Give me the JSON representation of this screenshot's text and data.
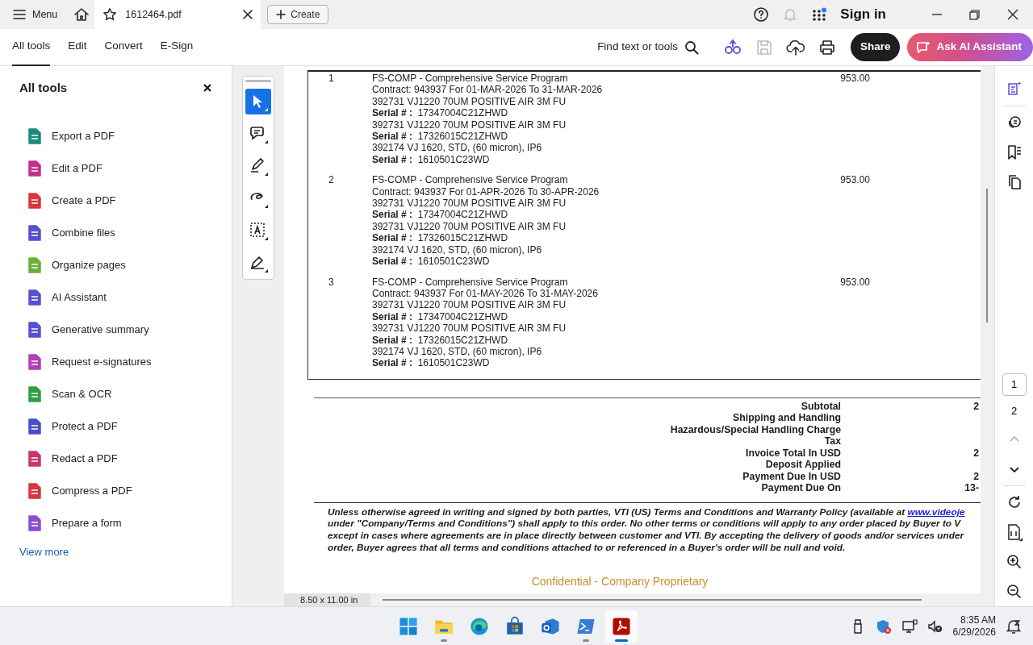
{
  "title_bar": {
    "menu": "Menu",
    "tab_title": "1612464.pdf",
    "create": "Create",
    "sign_in": "Sign in",
    "notifications_disabled": true
  },
  "toolbar": {
    "tabs": [
      {
        "label": "All tools",
        "selected": true
      },
      {
        "label": "Edit",
        "selected": false
      },
      {
        "label": "Convert",
        "selected": false
      },
      {
        "label": "E-Sign",
        "selected": false
      }
    ],
    "find": "Find text or tools",
    "save_disabled": true,
    "share": "Share",
    "ai_assistant": "Ask AI Assistant"
  },
  "tools_panel": {
    "title": "All tools",
    "items": [
      {
        "label": "Export a PDF",
        "color": "#1b8a7a"
      },
      {
        "label": "Edit a PDF",
        "color": "#c72f8c"
      },
      {
        "label": "Create a PDF",
        "color": "#d7373f"
      },
      {
        "label": "Combine files",
        "color": "#5a4fcf"
      },
      {
        "label": "Organize pages",
        "color": "#6bb036"
      },
      {
        "label": "AI Assistant",
        "color": "#5a4fcf"
      },
      {
        "label": "Generative summary",
        "color": "#5a4fcf"
      },
      {
        "label": "Request e-signatures",
        "color": "#b23fb5"
      },
      {
        "label": "Scan & OCR",
        "color": "#2f9e44"
      },
      {
        "label": "Protect a PDF",
        "color": "#4b4fc4"
      },
      {
        "label": "Redact a PDF",
        "color": "#c7356f"
      },
      {
        "label": "Compress a PDF",
        "color": "#d7373f"
      },
      {
        "label": "Prepare a form",
        "color": "#8a4fcf"
      }
    ],
    "view_more": "View more"
  },
  "quick_tools": [
    {
      "kind": "select",
      "selected": true
    },
    {
      "kind": "comment",
      "selected": false
    },
    {
      "kind": "highlight",
      "selected": false
    },
    {
      "kind": "draw",
      "selected": false
    },
    {
      "kind": "text",
      "selected": false
    },
    {
      "kind": "sign",
      "selected": false
    }
  ],
  "document": {
    "rows": [
      {
        "line": "1",
        "price": "953.00",
        "description": [
          "FS-COMP - Comprehensive Service Program",
          "Contract: 943937 For 01-MAR-2026 To 31-MAR-2026",
          "392731 VJ1220 70UM POSITIVE AIR 3M FU",
          "**Serial # :**  17347004C21ZHWD",
          "392731 VJ1220 70UM POSITIVE AIR 3M FU",
          "**Serial # :**  17326015C21ZHWD",
          "392174 VJ 1620, STD, (60 micron), IP6",
          "**Serial # :**  1610501C23WD"
        ]
      },
      {
        "line": "2",
        "price": "953.00",
        "description": [
          "FS-COMP - Comprehensive Service Program",
          "Contract: 943937 For 01-APR-2026 To 30-APR-2026",
          "392731 VJ1220 70UM POSITIVE AIR 3M FU",
          "**Serial # :**  17347004C21ZHWD",
          "392731 VJ1220 70UM POSITIVE AIR 3M FU",
          "**Serial # :**  17326015C21ZHWD",
          "392174 VJ 1620, STD, (60 micron), IP6",
          "**Serial # :**  1610501C23WD"
        ]
      },
      {
        "line": "3",
        "price": "953.00",
        "description": [
          "FS-COMP - Comprehensive Service Program",
          "Contract: 943937 For 01-MAY-2026 To 31-MAY-2026",
          "392731 VJ1220 70UM POSITIVE AIR 3M FU",
          "**Serial # :**  17347004C21ZHWD",
          "392731 VJ1220 70UM POSITIVE AIR 3M FU",
          "**Serial # :**  17326015C21ZHWD",
          "392174 VJ 1620, STD, (60 micron), IP6",
          "**Serial # :**  1610501C23WD"
        ]
      }
    ],
    "totals": [
      {
        "label": "Subtotal",
        "value": "2"
      },
      {
        "label": "Shipping and Handling"
      },
      {
        "label": "Hazardous/Special Handling Charge"
      },
      {
        "label": "Tax"
      },
      {
        "label": "Invoice Total In USD",
        "value": "2"
      },
      {
        "label": "Deposit Applied"
      },
      {
        "label": "Payment Due In USD",
        "value": "2"
      },
      {
        "label": "Payment Due On",
        "value": "13-"
      }
    ],
    "legal": {
      "lines": [
        "Unless otherwise agreed in writing and signed by both parties, VTI (US) Terms and Conditions and Warranty Policy (available at ",
        "under \"Company/Terms and Conditions\") shall apply to this order. No other terms or conditions will apply to any order placed by Buyer to V",
        "except in cases where agreements are in place directly between customer and VTI. By accepting the delivery of goods and/or services under",
        "order, Buyer agrees that all terms and conditions attached to or referenced in a Buyer's order will be null and void."
      ],
      "link": "www.videoje"
    },
    "footer": "Confidential - Company Proprietary"
  },
  "status_bar": {
    "page_size": "8.50 x 11.00 in"
  },
  "page_nav": {
    "pages": [
      {
        "label": "1",
        "selected": true
      },
      {
        "label": "2",
        "selected": false
      }
    ],
    "previous_disabled": true
  },
  "taskbar": {
    "apps": [
      {
        "kind": "start",
        "running": false,
        "active": false
      },
      {
        "kind": "files",
        "running": true,
        "active": false
      },
      {
        "kind": "browser",
        "running": false,
        "active": false
      },
      {
        "kind": "store",
        "running": false,
        "active": false
      },
      {
        "kind": "mail",
        "running": false,
        "active": false
      },
      {
        "kind": "terminal",
        "running": true,
        "active": false
      },
      {
        "kind": "pdf",
        "running": true,
        "active": true
      }
    ],
    "time": "8:35 AM",
    "date": "6/29/2026"
  }
}
